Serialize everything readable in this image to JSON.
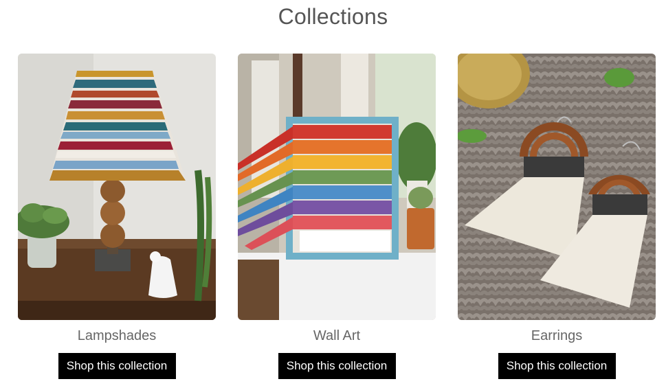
{
  "heading": "Collections",
  "collections": [
    {
      "name": "Lampshades",
      "image": "lampshade-photo",
      "button_label": "Shop this collection"
    },
    {
      "name": "Wall Art",
      "image": "wall-art-photo",
      "button_label": "Shop this collection"
    },
    {
      "name": "Earrings",
      "image": "earrings-photo",
      "button_label": "Shop this collection"
    }
  ],
  "colors": {
    "heading": "#555555",
    "label": "#666666",
    "button_bg": "#000000",
    "button_text": "#ffffff"
  }
}
